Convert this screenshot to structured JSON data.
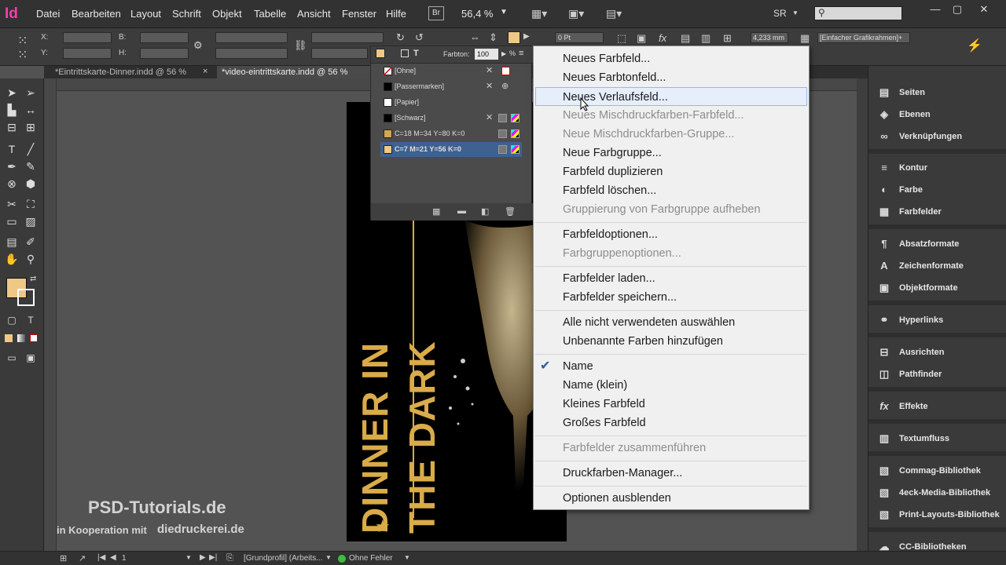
{
  "app": {
    "logo": "Id"
  },
  "menubar": {
    "items": [
      "Datei",
      "Bearbeiten",
      "Layout",
      "Schrift",
      "Objekt",
      "Tabelle",
      "Ansicht",
      "Fenster",
      "Hilfe"
    ],
    "bridge": "Br",
    "zoom": "56,4 %",
    "workspace": "SR",
    "window_buttons": [
      "—",
      "▢",
      "✕"
    ]
  },
  "control": {
    "x_label": "X:",
    "y_label": "Y:",
    "b_label": "B:",
    "h_label": "H:",
    "stroke_weight": "0 Pt",
    "dimension": "4,233 mm",
    "frame_style": "[Einfacher Grafikrahmen]+"
  },
  "tabs": [
    {
      "label": "*Eintrittskarte-Dinner.indd @ 56 %",
      "active": false
    },
    {
      "label": "*video-eintrittskarte.indd @ 56 %",
      "active": true
    }
  ],
  "swatch_panel": {
    "tint_label": "Farbton:",
    "tint_value": "100",
    "tint_unit": "%",
    "swatches": [
      {
        "name": "[Ohne]",
        "color": "#ffffff",
        "none": true
      },
      {
        "name": "[Passermarken]",
        "color": "#000000"
      },
      {
        "name": "[Papier]",
        "color": "#ffffff"
      },
      {
        "name": "[Schwarz]",
        "color": "#000000"
      },
      {
        "name": "C=18 M=34 Y=80 K=0",
        "color": "#d3a94e"
      },
      {
        "name": "C=7 M=21 Y=56 K=0",
        "color": "#eec884",
        "selected": true
      }
    ]
  },
  "context_menu": {
    "items": [
      {
        "label": "Neues Farbfeld...",
        "enabled": true
      },
      {
        "label": "Neues Farbtonfeld...",
        "enabled": true
      },
      {
        "label": "Neues Verlaufsfeld...",
        "enabled": true,
        "hover": true
      },
      {
        "label": "Neues Mischdruckfarben-Farbfeld...",
        "enabled": false
      },
      {
        "label": "Neue Mischdruckfarben-Gruppe...",
        "enabled": false
      },
      {
        "label": "Neue Farbgruppe...",
        "enabled": true
      },
      {
        "label": "Farbfeld duplizieren",
        "enabled": true
      },
      {
        "label": "Farbfeld löschen...",
        "enabled": true
      },
      {
        "label": "Gruppierung von Farbgruppe aufheben",
        "enabled": false
      },
      {
        "label": "Farbfeldoptionen...",
        "enabled": true
      },
      {
        "label": "Farbgruppenoptionen...",
        "enabled": false
      },
      {
        "label": "Farbfelder laden...",
        "enabled": true
      },
      {
        "label": "Farbfelder speichern...",
        "enabled": true
      },
      {
        "label": "Alle nicht verwendeten auswählen",
        "enabled": true
      },
      {
        "label": "Unbenannte Farben hinzufügen",
        "enabled": true
      },
      {
        "label": "Name",
        "enabled": true,
        "checked": true
      },
      {
        "label": "Name (klein)",
        "enabled": true
      },
      {
        "label": "Kleines Farbfeld",
        "enabled": true
      },
      {
        "label": "Großes Farbfeld",
        "enabled": true
      },
      {
        "label": "Farbfelder zusammenführen",
        "enabled": false
      },
      {
        "label": "Druckfarben-Manager...",
        "enabled": true
      },
      {
        "label": "Optionen ausblenden",
        "enabled": true
      }
    ]
  },
  "right_panel": {
    "items": [
      {
        "label": "Seiten",
        "icon": "pages-icon",
        "glyph": "▤"
      },
      {
        "label": "Ebenen",
        "icon": "layers-icon",
        "glyph": "◈"
      },
      {
        "label": "Verknüpfungen",
        "icon": "links-icon",
        "glyph": "∞"
      },
      {
        "label": "Kontur",
        "icon": "stroke-icon",
        "glyph": "≡"
      },
      {
        "label": "Farbe",
        "icon": "color-icon",
        "glyph": "◐"
      },
      {
        "label": "Farbfelder",
        "icon": "swatches-icon",
        "glyph": "▦"
      },
      {
        "label": "Absatzformate",
        "icon": "paragraph-styles-icon",
        "glyph": "¶"
      },
      {
        "label": "Zeichenformate",
        "icon": "character-styles-icon",
        "glyph": "A"
      },
      {
        "label": "Objektformate",
        "icon": "object-styles-icon",
        "glyph": "▣"
      },
      {
        "label": "Hyperlinks",
        "icon": "hyperlinks-icon",
        "glyph": "⚭"
      },
      {
        "label": "Ausrichten",
        "icon": "align-icon",
        "glyph": "⊟"
      },
      {
        "label": "Pathfinder",
        "icon": "pathfinder-icon",
        "glyph": "◫"
      },
      {
        "label": "Effekte",
        "icon": "effects-icon",
        "glyph": "fx"
      },
      {
        "label": "Textumfluss",
        "icon": "text-wrap-icon",
        "glyph": "▥"
      },
      {
        "label": "Commag-Bibliothek",
        "icon": "library-icon",
        "glyph": "▧"
      },
      {
        "label": "4eck-Media-Bibliothek",
        "icon": "library-icon",
        "glyph": "▧"
      },
      {
        "label": "Print-Layouts-Bibliothek",
        "icon": "library-icon",
        "glyph": "▧"
      },
      {
        "label": "CC-Bibliotheken",
        "icon": "cc-libraries-icon",
        "glyph": "☁"
      }
    ]
  },
  "document": {
    "headline": "DINNER IN THE DARK",
    "gold": "#d9ab49"
  },
  "status": {
    "page": "1",
    "profile": "[Grundprofil] (Arbeits...",
    "preflight": "Ohne Fehler"
  },
  "watermark": {
    "brand": "PSD-Tutorials.de",
    "coop": "in Kooperation mit",
    "partner": "diedruckerei.de"
  },
  "colors": {
    "fill_swatch": "#eec884",
    "selection": "#3e6191",
    "accent_logo": "#ff3cac"
  }
}
